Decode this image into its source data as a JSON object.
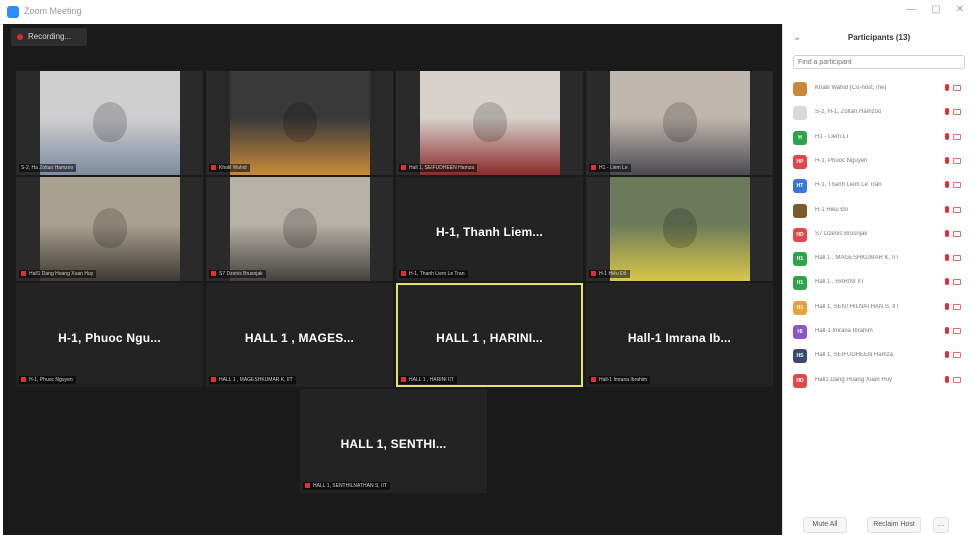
{
  "window": {
    "title": "Zoom Meeting"
  },
  "recording": {
    "label": "Recording..."
  },
  "tiles": [
    {
      "type": "video",
      "name": "S-2, Ha Zoltan Hamzoo",
      "muted": false,
      "bg": "#cfcfcf",
      "box": "#7c8aa0"
    },
    {
      "type": "video",
      "name": "Khalil Wahid",
      "muted": true,
      "bg": "#3a3a3a",
      "box": "#c88a3a"
    },
    {
      "type": "video",
      "name": "Hall 1, SEIFUDHEEN Hamza",
      "muted": true,
      "bg": "#d8d2cc",
      "box": "#8a2a2a"
    },
    {
      "type": "video",
      "name": "H1 - Liem Le",
      "muted": true,
      "bg": "#bfb6ad",
      "box": "#4a4a52"
    },
    {
      "type": "video",
      "name": "Hall1 Dang Hoang Xuan Huy",
      "muted": true,
      "bg": "#a9a28e",
      "box": "#3e3a34"
    },
    {
      "type": "video",
      "name": "S7 Dzenis Brusnjak",
      "muted": true,
      "bg": "#b6b1a6",
      "box": "#45423e"
    },
    {
      "type": "name",
      "label": "H-1, Thanh Liem...",
      "name": "H-1, Thanh Liem Le Tran",
      "muted": true
    },
    {
      "type": "video",
      "name": "H-1 Hiếu Đỗ",
      "muted": true,
      "bg": "#6b7a5a",
      "box": "#d8c74a"
    },
    {
      "type": "name",
      "label": "H-1, Phuoc Ngu...",
      "name": "H-1, Phuoc Nguyen",
      "muted": true
    },
    {
      "type": "name",
      "label": "HALL 1 ,  MAGES...",
      "name": "HALL 1 ,  MAGESHKUMAR K, IIT",
      "muted": true
    },
    {
      "type": "name",
      "label": "HALL 1 , HARINI...",
      "name": "HALL 1 , HARINI IIT",
      "muted": true,
      "active": true
    },
    {
      "type": "name",
      "label": "Hall-1 Imrana Ib...",
      "name": "Hall-1 Imrana Ibrahim",
      "muted": true
    },
    {
      "type": "name",
      "label": "HALL 1, SENTHI...",
      "name": "HALL 1, SENTHILNATHAN S, IIT",
      "muted": true
    }
  ],
  "panel": {
    "title": "Participants (13)",
    "search_placeholder": "Find a participant",
    "participants": [
      {
        "initials": "",
        "name": "Khalil Wahid (Co-host, me)",
        "color": "#c88a3a"
      },
      {
        "initials": "",
        "name": "S-2, H-1, Zoltan Hamzoo",
        "color": "#d9d9d9"
      },
      {
        "initials": "H",
        "name": "H1 - Liem LT",
        "color": "#2fa34a"
      },
      {
        "initials": "HP",
        "name": "H-1, Phuoc Nguyen",
        "color": "#e0464a"
      },
      {
        "initials": "HT",
        "name": "H-1, Thanh Liem Le Tran",
        "color": "#3a78d8"
      },
      {
        "initials": "",
        "name": "H-1 Hiếu Đỗ",
        "color": "#7a5a2a"
      },
      {
        "initials": "HD",
        "name": "S7 Dzenis Brusnjak",
        "color": "#e04a4a"
      },
      {
        "initials": "H1",
        "name": "Hall 1 , MAGESHKUMAR K, IIT",
        "color": "#2fa34a"
      },
      {
        "initials": "H1",
        "name": "Hall 1 , HARINI IIT",
        "color": "#2fa34a"
      },
      {
        "initials": "H1",
        "name": "Hall 1, SENTHILNATHAN S, IIT",
        "color": "#e8a23a"
      },
      {
        "initials": "HI",
        "name": "Hall-1 Imrana Ibrahim",
        "color": "#8a56c8"
      },
      {
        "initials": "HS",
        "name": "Hall 1, SEIFUDHEEN Hamza",
        "color": "#3b4b74"
      },
      {
        "initials": "HD",
        "name": "Hall1 Dang Hoang Xuan Huy",
        "color": "#e04a4a"
      }
    ],
    "buttons": {
      "mute_all": "Mute All",
      "reclaim_host": "Reclaim Host"
    }
  },
  "colors": {
    "muted_red": "#e03030",
    "active_speaker": "#e3e36b"
  }
}
